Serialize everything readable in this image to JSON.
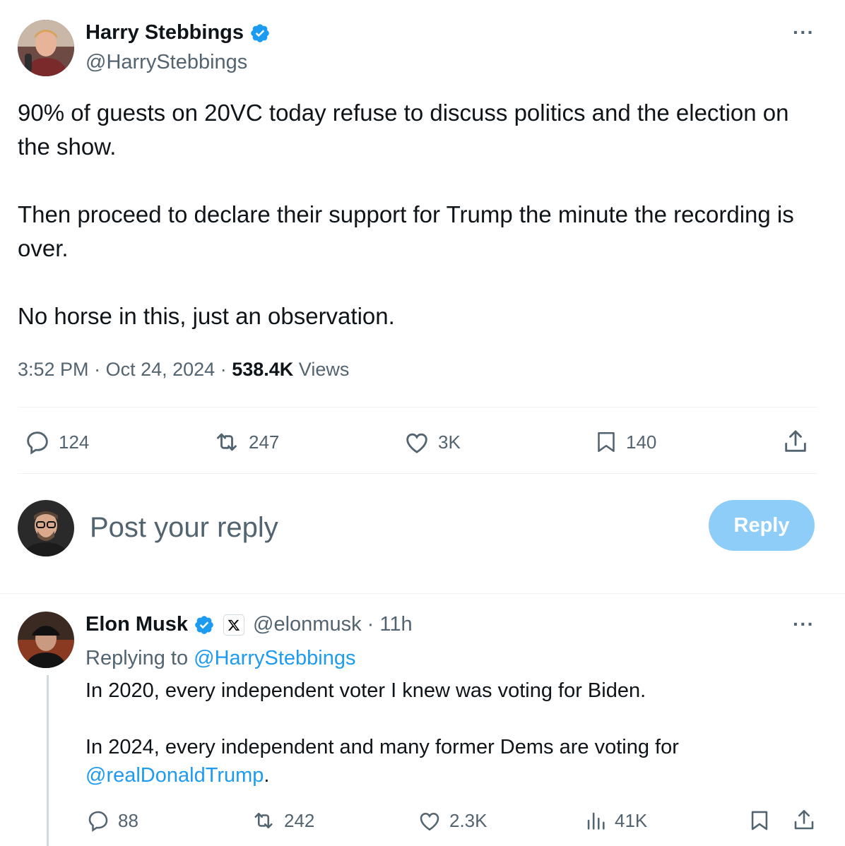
{
  "tweet": {
    "author_name": "Harry Stebbings",
    "author_handle": "@HarryStebbings",
    "text": "90% of guests on 20VC today refuse to discuss politics and the election on the show.\n\nThen proceed to declare their support for Trump the minute the recording is over.\n\nNo horse in this, just an observation.",
    "time": "3:52 PM",
    "date": "Oct 24, 2024",
    "views_count": "538.4K",
    "views_label": "Views",
    "more_label": "···",
    "actions": {
      "replies": "124",
      "reposts": "247",
      "likes": "3K",
      "bookmarks": "140"
    }
  },
  "composer": {
    "placeholder": "Post your reply",
    "reply_button": "Reply"
  },
  "reply": {
    "author_name": "Elon Musk",
    "author_handle": "@elonmusk",
    "time_ago": "11h",
    "replying_to_label": "Replying to",
    "replying_to_handle": "@HarryStebbings",
    "line1": "In 2020, every independent voter I knew was voting for Biden.",
    "line2": "In 2024, every independent and many former Dems are voting for",
    "mention": "@realDonaldTrump",
    "line2_end": ".",
    "more_label": "···",
    "actions": {
      "replies": "88",
      "reposts": "242",
      "likes": "2.3K",
      "views": "41K"
    }
  },
  "colors": {
    "accent": "#1d9bf0",
    "reply_button": "#8ecdf8",
    "muted_text": "#536471"
  }
}
